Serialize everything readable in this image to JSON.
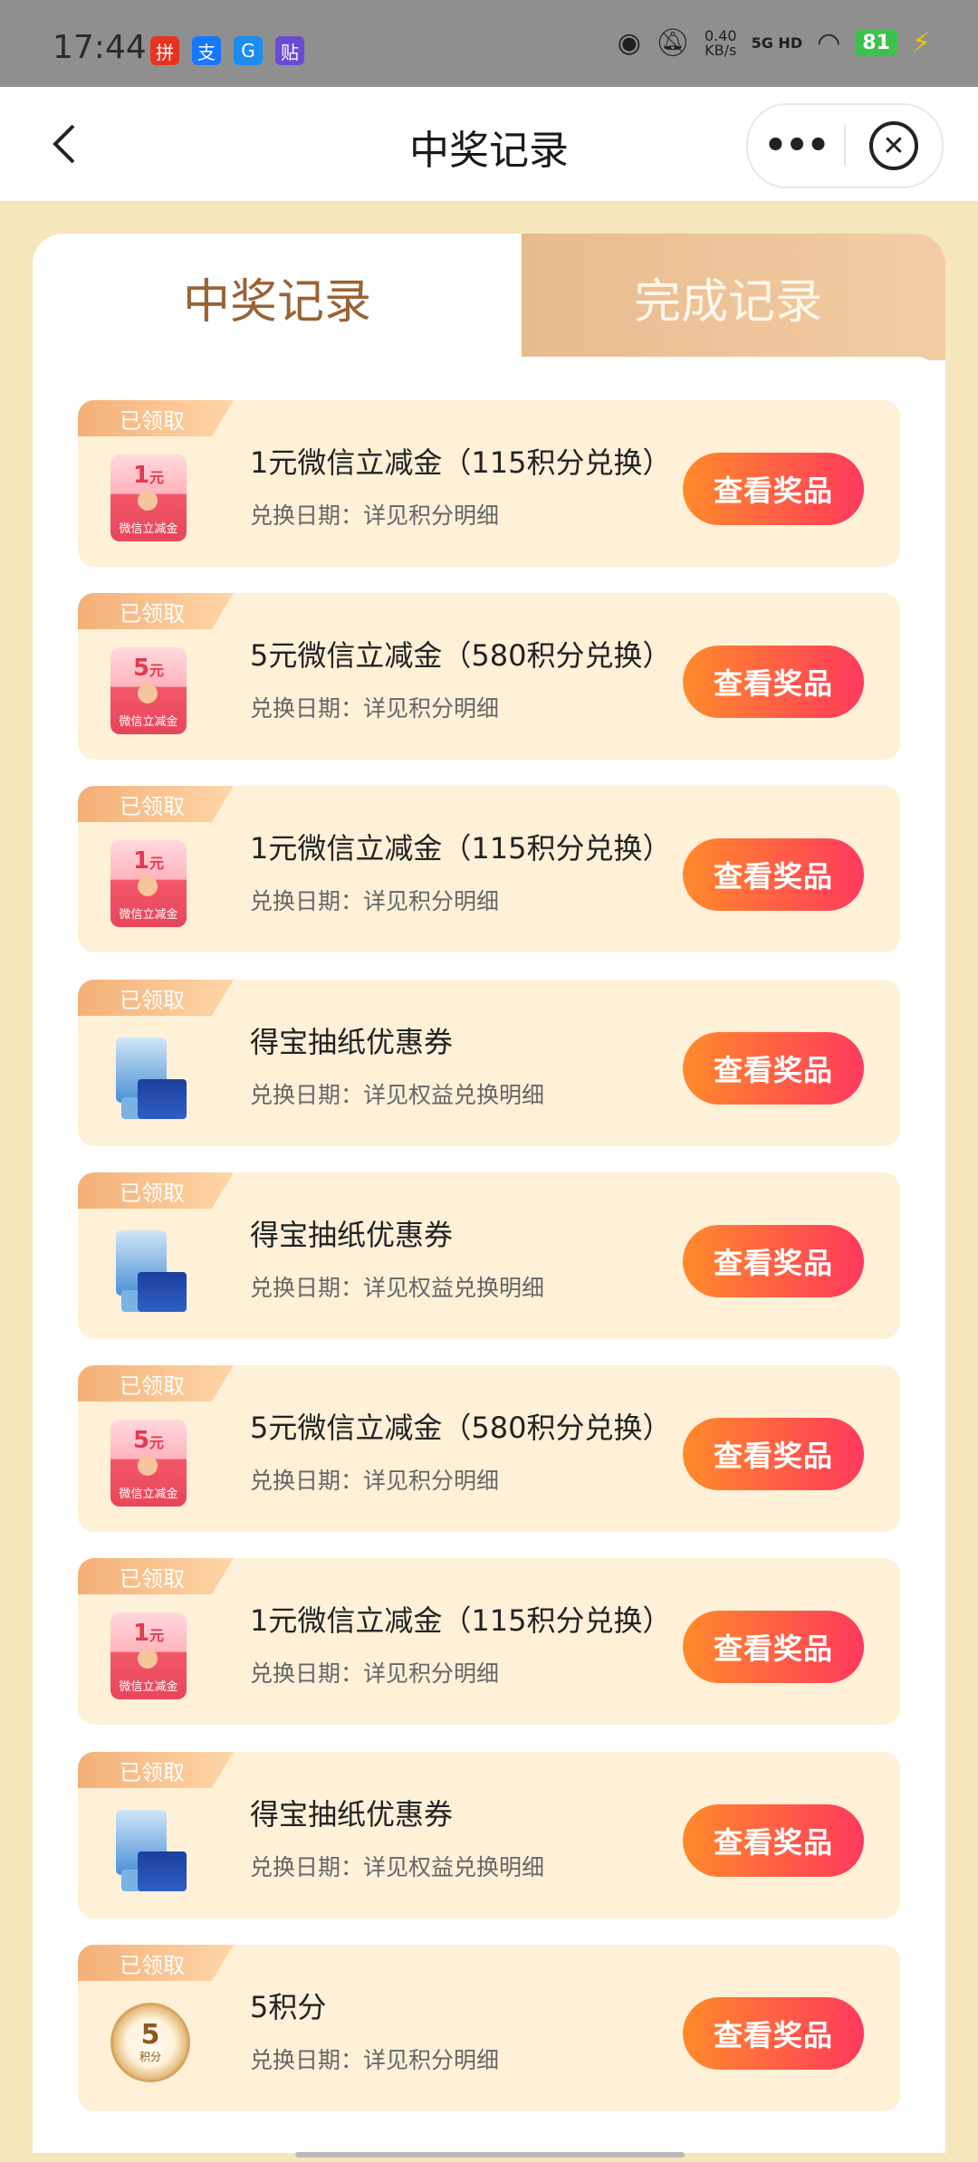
{
  "status_bar": {
    "time": "17:44",
    "app_icons": [
      "拼",
      "支",
      "G",
      "贴"
    ],
    "speed_value": "0.40",
    "speed_unit": "KB/s",
    "network": "5G HD",
    "battery": "81"
  },
  "navbar": {
    "title": "中奖记录",
    "more_glyph": "•••",
    "close_glyph": "✕"
  },
  "tabs": {
    "active": "中奖记录",
    "inactive": "完成记录"
  },
  "records": [
    {
      "badge": "已领取",
      "thumb": "coupon",
      "coupon_amount": "1",
      "coupon_unit": "元",
      "coupon_label": "微信立减金",
      "title": "1元微信立减金（115积分兑换）",
      "subtitle": "兑换日期：详见积分明细",
      "button": "查看奖品"
    },
    {
      "badge": "已领取",
      "thumb": "coupon",
      "coupon_amount": "5",
      "coupon_unit": "元",
      "coupon_label": "微信立减金",
      "title": "5元微信立减金（580积分兑换）",
      "subtitle": "兑换日期：详见积分明细",
      "button": "查看奖品"
    },
    {
      "badge": "已领取",
      "thumb": "coupon",
      "coupon_amount": "1",
      "coupon_unit": "元",
      "coupon_label": "微信立减金",
      "title": "1元微信立减金（115积分兑换）",
      "subtitle": "兑换日期：详见积分明细",
      "button": "查看奖品"
    },
    {
      "badge": "已领取",
      "thumb": "tissue",
      "title": "得宝抽纸优惠券",
      "subtitle": "兑换日期：详见权益兑换明细",
      "button": "查看奖品"
    },
    {
      "badge": "已领取",
      "thumb": "tissue",
      "title": "得宝抽纸优惠券",
      "subtitle": "兑换日期：详见权益兑换明细",
      "button": "查看奖品"
    },
    {
      "badge": "已领取",
      "thumb": "coupon",
      "coupon_amount": "5",
      "coupon_unit": "元",
      "coupon_label": "微信立减金",
      "title": "5元微信立减金（580积分兑换）",
      "subtitle": "兑换日期：详见积分明细",
      "button": "查看奖品"
    },
    {
      "badge": "已领取",
      "thumb": "coupon",
      "coupon_amount": "1",
      "coupon_unit": "元",
      "coupon_label": "微信立减金",
      "title": "1元微信立减金（115积分兑换）",
      "subtitle": "兑换日期：详见积分明细",
      "button": "查看奖品"
    },
    {
      "badge": "已领取",
      "thumb": "tissue",
      "title": "得宝抽纸优惠券",
      "subtitle": "兑换日期：详见权益兑换明细",
      "button": "查看奖品"
    },
    {
      "badge": "已领取",
      "thumb": "coin",
      "coin_amount": "5",
      "coin_unit": "积分",
      "title": "5积分",
      "subtitle": "兑换日期：详见积分明细",
      "button": "查看奖品"
    }
  ],
  "colors": {
    "page_bg": "#f6e6bc",
    "card_bg": "#fff0d8",
    "button_gradient_start": "#ff8a2a",
    "button_gradient_end": "#ff3a5c",
    "active_tab_text": "#9a6334"
  }
}
